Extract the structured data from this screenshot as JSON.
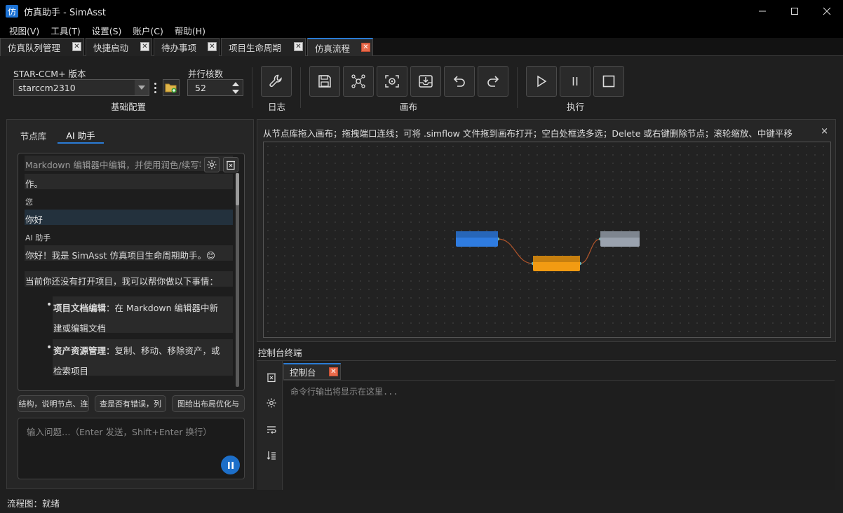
{
  "window": {
    "icon_char": "仿",
    "title": "仿真助手 - SimAsst"
  },
  "menu": [
    "视图(V)",
    "工具(T)",
    "设置(S)",
    "账户(C)",
    "帮助(H)"
  ],
  "doc_tabs": [
    {
      "label": "仿真队列管理"
    },
    {
      "label": "快捷启动"
    },
    {
      "label": "待办事项"
    },
    {
      "label": "项目生命周期"
    },
    {
      "label": "仿真流程",
      "active": true
    }
  ],
  "toolbar": {
    "version_label": "STAR-CCM+ 版本",
    "version_value": "starccm2310",
    "cores_label": "并行核数",
    "cores_value": "52",
    "group_basic": "基础配置",
    "group_log": "日志",
    "group_canvas": "画布",
    "group_run": "执行"
  },
  "left_panel": {
    "tabs": [
      "节点库",
      "AI 助手"
    ],
    "active_tab": 1,
    "chat": {
      "line1": "Markdown 编辑器中编辑，并使用润色/续写等快捷操",
      "line2": "作。",
      "user_label": "您",
      "user_msg": "你好",
      "ai_label": "AI 助手",
      "ai_msg1": "你好！我是 SimAsst 仿真项目生命周期助手。😊",
      "ai_msg2": "当前你还没有打开项目，我可以帮你做以下事情：",
      "bullet1_bold": "项目文档编辑",
      "bullet1_rest": "：在 Markdown 编辑器中新",
      "bullet1_line2": "建或编辑文档",
      "bullet2_bold": "资产资源管理",
      "bullet2_rest": "：复制、移动、移除资产，或",
      "bullet2_line2": "检索项目"
    },
    "chips": [
      "结构，说明节点、连",
      "查是否有错误，列",
      "图给出布局优化与"
    ],
    "input_placeholder": "输入问题…（Enter 发送，Shift+Enter 换行）"
  },
  "canvas": {
    "hint": "从节点库拖入画布；拖拽端口连线；可将 .simflow 文件拖到画布打开；空白处框选多选；Delete 或右键删除节点；滚轮缩放、中键平移",
    "close": "×",
    "node_colors": [
      "#2f7ce0",
      "#f29b12",
      "#9aa2ae"
    ],
    "edge_color": "#b0542a"
  },
  "console": {
    "title": "控制台终端",
    "tab": "控制台",
    "placeholder": "命令行输出将显示在这里..."
  },
  "status": {
    "text": "流程图：就绪"
  }
}
